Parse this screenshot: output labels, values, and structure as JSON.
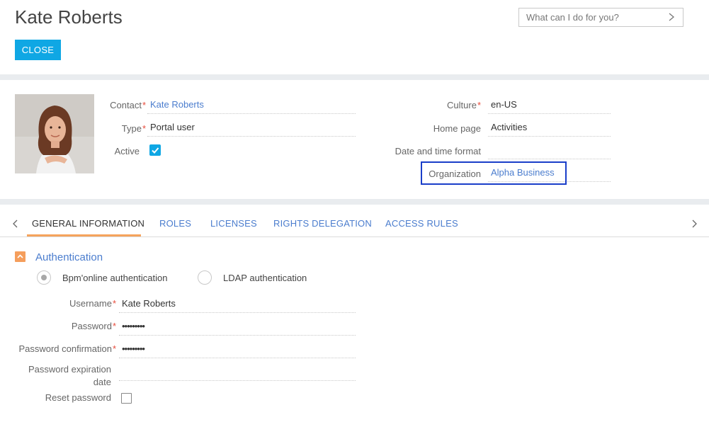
{
  "page": {
    "title": "Kate Roberts"
  },
  "toolbar": {
    "close_label": "CLOSE"
  },
  "command": {
    "placeholder": "What can I do for you?"
  },
  "profile": {
    "contact": {
      "label": "Contact",
      "value": "Kate Roberts"
    },
    "type": {
      "label": "Type",
      "value": "Portal user"
    },
    "active": {
      "label": "Active",
      "checked": true
    },
    "culture": {
      "label": "Culture",
      "value": "en-US"
    },
    "home_page": {
      "label": "Home page",
      "value": "Activities"
    },
    "date_time_format": {
      "label": "Date and time format",
      "value": ""
    },
    "organization": {
      "label": "Organization",
      "value": "Alpha Business"
    }
  },
  "tabs": [
    {
      "label": "GENERAL INFORMATION",
      "active": true
    },
    {
      "label": "ROLES"
    },
    {
      "label": "LICENSES"
    },
    {
      "label": "RIGHTS DELEGATION"
    },
    {
      "label": "ACCESS RULES"
    }
  ],
  "auth": {
    "group_title": "Authentication",
    "options": [
      {
        "label": "Bpm'online authentication",
        "selected": true
      },
      {
        "label": "LDAP authentication",
        "selected": false
      }
    ],
    "username": {
      "label": "Username",
      "value": "Kate Roberts"
    },
    "password": {
      "label": "Password",
      "value": "•••••••••"
    },
    "password_confirmation": {
      "label": "Password confirmation",
      "value": "•••••••••"
    },
    "password_expiration": {
      "label_line1": "Password expiration",
      "label_line2": "date",
      "value": ""
    },
    "reset_password": {
      "label": "Reset password",
      "checked": false
    }
  },
  "colors": {
    "accent": "#0fa7e4",
    "link": "#4b7dce",
    "tab_underline": "#f5a35c",
    "highlight": "#1a3ec9"
  }
}
